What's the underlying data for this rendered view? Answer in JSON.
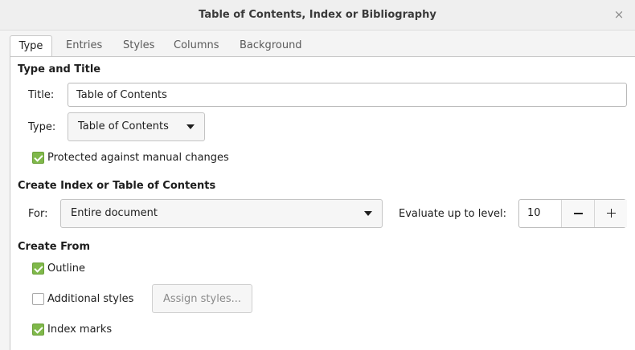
{
  "window": {
    "title": "Table of Contents, Index or Bibliography",
    "close_glyph": "×"
  },
  "tabs": [
    {
      "label": "Type",
      "active": true
    },
    {
      "label": "Entries",
      "active": false
    },
    {
      "label": "Styles",
      "active": false
    },
    {
      "label": "Columns",
      "active": false
    },
    {
      "label": "Background",
      "active": false
    }
  ],
  "type_and_title": {
    "heading": "Type and Title",
    "title_label": "Title:",
    "title_value": "Table of Contents",
    "type_label": "Type:",
    "type_value": "Table of Contents",
    "protected_label": "Protected against manual changes",
    "protected_checked": true
  },
  "create_index": {
    "heading": "Create Index or Table of Contents",
    "for_label": "For:",
    "for_value": "Entire document",
    "evaluate_label": "Evaluate up to level:",
    "level_value": "10",
    "minus_glyph": "−",
    "plus_glyph": "+"
  },
  "create_from": {
    "heading": "Create From",
    "outline_label": "Outline",
    "outline_checked": true,
    "additional_label": "Additional styles",
    "additional_checked": false,
    "assign_button": "Assign styles...",
    "index_marks_label": "Index marks",
    "index_marks_checked": true
  },
  "colors": {
    "check_green": "#7fb84a",
    "panel_bg": "#ffffff",
    "window_bg": "#f4f4f4"
  }
}
